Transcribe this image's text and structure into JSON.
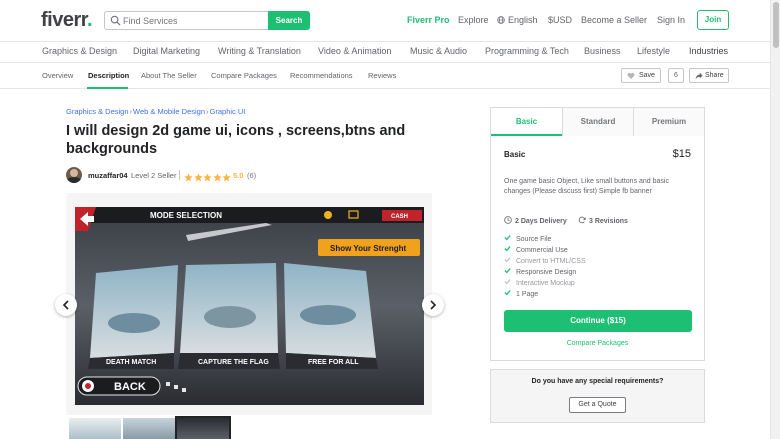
{
  "brand": {
    "logo_text": "fiverr",
    "accent": "#1dbf73"
  },
  "search": {
    "placeholder": "Find Services",
    "button_label": "Search"
  },
  "top_nav": {
    "pro": "Fiverr Pro",
    "explore": "Explore",
    "language": "English",
    "currency": "$USD",
    "become_seller": "Become a Seller",
    "sign_in": "Sign In",
    "join": "Join"
  },
  "categories": [
    "Graphics & Design",
    "Digital Marketing",
    "Writing & Translation",
    "Video & Animation",
    "Music & Audio",
    "Programming & Tech",
    "Business",
    "Lifestyle",
    "Industries"
  ],
  "sub_tabs": [
    "Overview",
    "Description",
    "About The Seller",
    "Compare Packages",
    "Recommendations",
    "Reviews"
  ],
  "active_sub_tab": "Description",
  "actions": {
    "save_label": "Save",
    "save_count": "6",
    "share_label": "Share"
  },
  "breadcrumb": [
    "Graphics & Design",
    "Web & Mobile Design",
    "Graphic UI"
  ],
  "gig": {
    "title": "I will design 2d game ui, icons , screens,btns and backgrounds",
    "seller_name": "muzaffar04",
    "seller_level": "Level 2 Seller",
    "stars": 5,
    "rating": "5.0",
    "reviews": "(6)"
  },
  "game_screen": {
    "header": "MODE SELECTION",
    "cash_label": "CASH",
    "banner": "Show Your Strenght",
    "modes": [
      "DEATH MATCH",
      "CAPTURE THE FLAG",
      "FREE FOR ALL"
    ],
    "back_label": "BACK"
  },
  "packages": {
    "tabs": [
      "Basic",
      "Standard",
      "Premium"
    ],
    "active": "Basic",
    "name": "Basic",
    "price": "$15",
    "description": "One game basic Object, Like small buttons and basic changes (Please discuss first) Simple fb banner",
    "delivery": "2 Days Delivery",
    "revisions": "3 Revisions",
    "features": [
      {
        "label": "Source File",
        "included": true
      },
      {
        "label": "Commercial Use",
        "included": true
      },
      {
        "label": "Convert to HTML/CSS",
        "included": false
      },
      {
        "label": "Responsive Design",
        "included": true
      },
      {
        "label": "Interactive Mockup",
        "included": false
      },
      {
        "label": "1 Page",
        "included": true
      }
    ],
    "continue_label": "Continue ($15)",
    "compare_label": "Compare Packages"
  },
  "requirements": {
    "question": "Do you have any special requirements?",
    "button": "Get a Quote"
  }
}
